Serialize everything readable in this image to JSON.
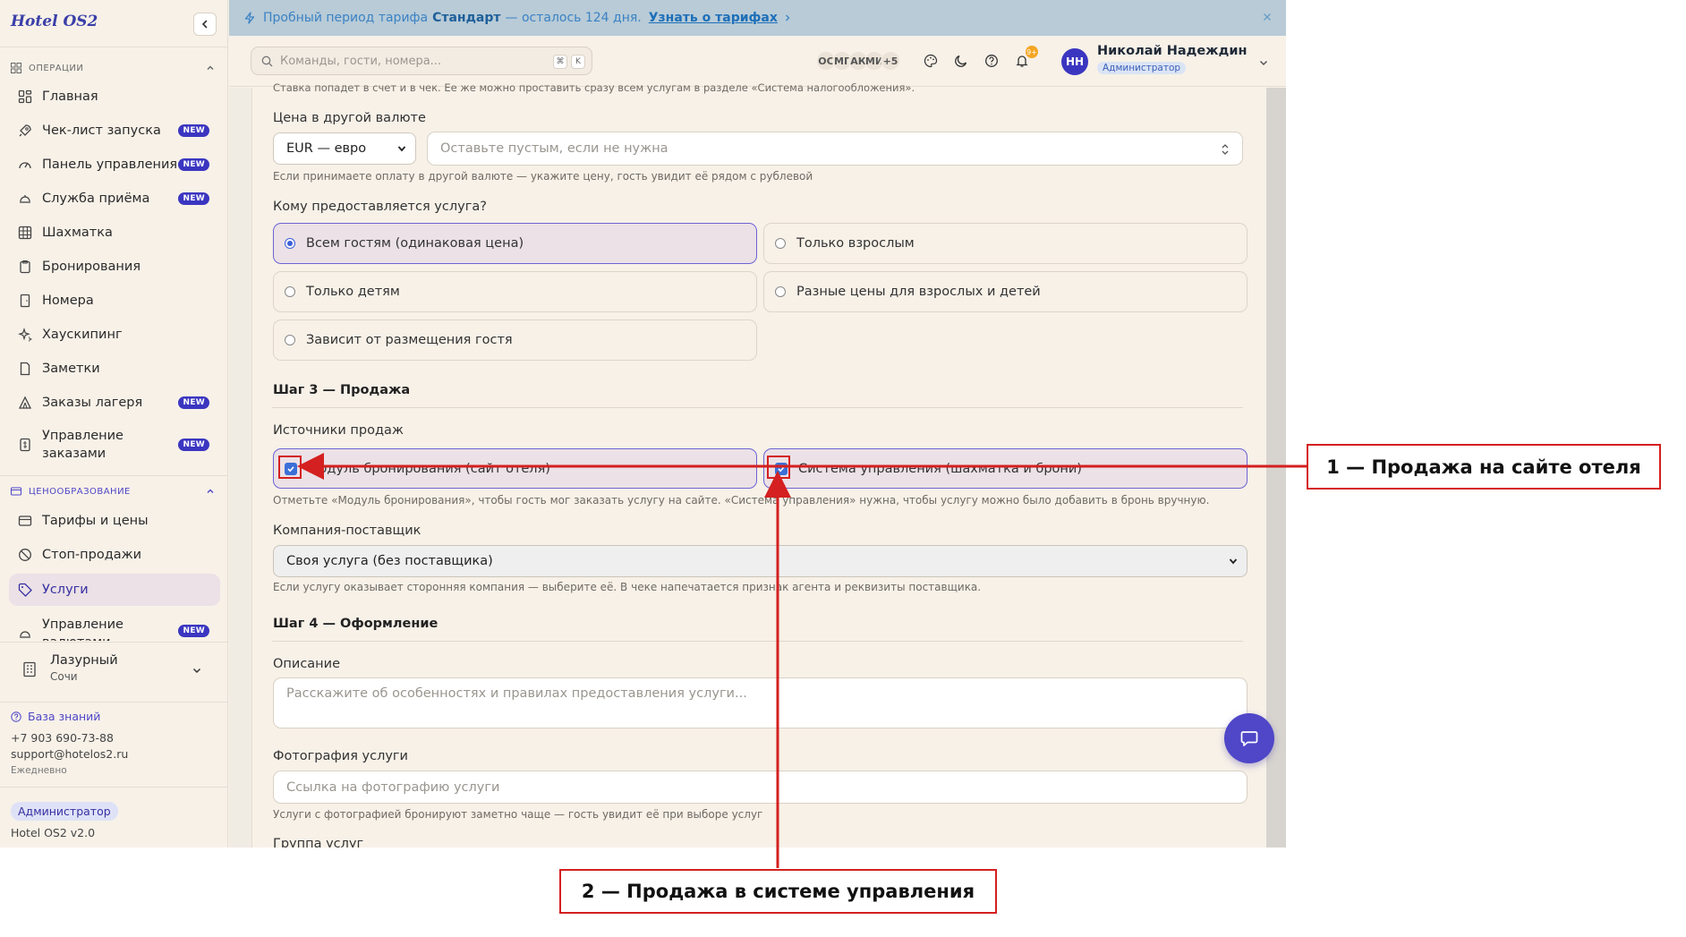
{
  "sidebar": {
    "logo": "Hotel OS2",
    "sections": [
      {
        "title": "ОПЕРАЦИИ"
      },
      {
        "title": "ЦЕНООБРАЗОВАНИЕ"
      }
    ],
    "items": [
      {
        "label": "Главная",
        "badge": ""
      },
      {
        "label": "Чек-лист запуска",
        "badge": "NEW"
      },
      {
        "label": "Панель управления",
        "badge": "NEW"
      },
      {
        "label": "Служба приёма",
        "badge": "NEW"
      },
      {
        "label": "Шахматка",
        "badge": ""
      },
      {
        "label": "Бронирования",
        "badge": ""
      },
      {
        "label": "Номера",
        "badge": ""
      },
      {
        "label": "Хаускипинг",
        "badge": ""
      },
      {
        "label": "Заметки",
        "badge": ""
      },
      {
        "label": "Заказы лагеря",
        "badge": "NEW"
      },
      {
        "label_line1": "Управление",
        "label_line2": "заказами",
        "badge": "NEW"
      },
      {
        "label": "Тарифы и цены",
        "badge": ""
      },
      {
        "label": "Стоп-продажи",
        "badge": ""
      },
      {
        "label": "Услуги",
        "badge": "",
        "active": true
      },
      {
        "label_line1": "Управление",
        "label_line2": "валютами",
        "badge": "NEW"
      }
    ],
    "hotel": {
      "name": "Лазурный",
      "city": "Сочи"
    },
    "knowledge_base": "База знаний",
    "phone": "+7 903 690-73-88",
    "email": "support@hotelos2.ru",
    "hours": "Ежедневно",
    "role": "Администратор",
    "version": "Hotel OS2 v2.0"
  },
  "banner": {
    "text_before": "Пробный период тарифа",
    "plan": "Стандарт",
    "text_after": "— осталось 124 дня.",
    "link": "Узнать о тарифах"
  },
  "topbar": {
    "search_placeholder": "Команды, гости, номера...",
    "kbd1": "⌘",
    "kbd2": "K",
    "presence": [
      "ОС",
      "МГ",
      "АК",
      "МИ",
      "+5"
    ],
    "notif_count": "9+",
    "user_initials": "НН",
    "user_name": "Николай Надеждин",
    "user_role": "Администратор"
  },
  "form": {
    "top_hint": "Ставка попадет в счет и в чек. Ее же можно проставить сразу всем услугам в разделе «Система налогообложения».",
    "currency_label": "Цена в другой валюте",
    "currency_value": "EUR — евро",
    "currency_price_placeholder": "Оставьте пустым, если не нужна",
    "currency_hint": "Если принимаете оплату в другой валюте — укажите цену, гость увидит её рядом с рублевой",
    "audience_label": "Кому предоставляется услуга?",
    "audience_options": [
      {
        "label": "Всем гостям (одинаковая цена)",
        "selected": true
      },
      {
        "label": "Только взрослым",
        "selected": false
      },
      {
        "label": "Только детям",
        "selected": false
      },
      {
        "label": "Разные цены для взрослых и детей",
        "selected": false
      },
      {
        "label": "Зависит от размещения гостя",
        "selected": false
      }
    ],
    "step3_title": "Шаг 3 — Продажа",
    "sources_label": "Источники продаж",
    "sources": [
      {
        "label": "Модуль бронирования (сайт отеля)",
        "checked": true
      },
      {
        "label": "Система управления (шахматка и брони)",
        "checked": true
      }
    ],
    "sources_hint": "Отметьте «Модуль бронирования», чтобы гость мог заказать услугу на сайте. «Система управления» нужна, чтобы услугу можно было добавить в бронь вручную.",
    "supplier_label": "Компания-поставщик",
    "supplier_value": "Своя услуга (без поставщика)",
    "supplier_hint": "Если услугу оказывает сторонняя компания — выберите её. В чеке напечатается признак агента и реквизиты поставщика.",
    "step4_title": "Шаг 4 — Оформление",
    "description_label": "Описание",
    "description_placeholder": "Расскажите об особенностях и правилах предоставления услуги...",
    "photo_label": "Фотография услуги",
    "photo_placeholder": "Ссылка на фотографию услуги",
    "photo_hint": "Услуги с фотографией бронируют заметно чаще — гость увидит её при выборе услуг",
    "group_label": "Группа услуг"
  },
  "annotations": {
    "callout1": "1 — Продажа на сайте отеля",
    "callout2": "2 — Продажа в системе управления",
    "color": "#d42020"
  },
  "colors": {
    "accent": "#3b36c0",
    "banner_bg": "#b8cbd7",
    "page_bg": "#f7f1e8"
  }
}
